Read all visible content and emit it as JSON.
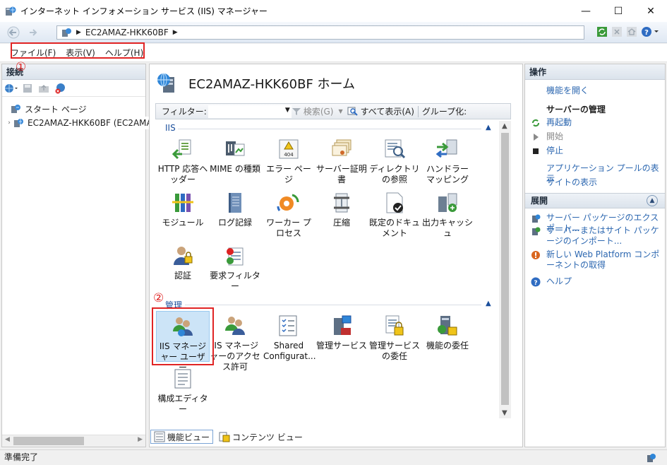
{
  "window": {
    "title": "インターネット インフォメーション サービス (IIS) マネージャー",
    "minimize": "—",
    "maximize": "☐",
    "close": "✕"
  },
  "address": {
    "crumb": "EC2AMAZ-HKK60BF"
  },
  "menu": [
    "ファイル(F)",
    "表示(V)",
    "ヘルプ(H)"
  ],
  "connections": {
    "header": "接続",
    "tree": [
      {
        "label": "スタート ページ"
      },
      {
        "label": "EC2AMAZ-HKK60BF (EC2AMAZ"
      }
    ],
    "marker1": "①"
  },
  "center": {
    "title": "EC2AMAZ-HKK60BF ホーム",
    "filter_label": "フィルター:",
    "search_label": "検索(G)",
    "show_all_label": "すべて表示(A)",
    "group_label": "グループ化:",
    "group_iis": "IIS",
    "group_manage": "管理",
    "marker2": "②",
    "iis_features": [
      "HTTP 応答ヘッダー",
      "MIME の種類",
      "エラー ページ",
      "サーバー証明書",
      "ディレクトリの参照",
      "ハンドラー マッピング",
      "モジュール",
      "ログ記録",
      "ワーカー プロセス",
      "圧縮",
      "既定のドキュメント",
      "出力キャッシュ",
      "認証",
      "要求フィルター"
    ],
    "manage_features": [
      "IIS マネージャー ユーザー",
      "IIS マネージャーのアクセス許可",
      "Shared Configurat...",
      "管理サービス",
      "管理サービスの委任",
      "機能の委任",
      "構成エディター"
    ],
    "view_tabs": [
      "機能ビュー",
      "コンテンツ ビュー"
    ]
  },
  "actions": {
    "header": "操作",
    "open_feature": "機能を開く",
    "server_manage": "サーバーの管理",
    "restart": "再起動",
    "start": "開始",
    "stop": "停止",
    "app_pools": "アプリケーション プールの表示",
    "sites": "サイトの表示",
    "deploy_header": "展開",
    "export_pkg": "サーバー パッケージのエクスポート...",
    "import_pkg": "サーバーまたはサイト パッケージのインポート...",
    "web_platform": "新しい Web Platform コンポーネントの取得",
    "help": "ヘルプ"
  },
  "status": {
    "text": "準備完了"
  }
}
